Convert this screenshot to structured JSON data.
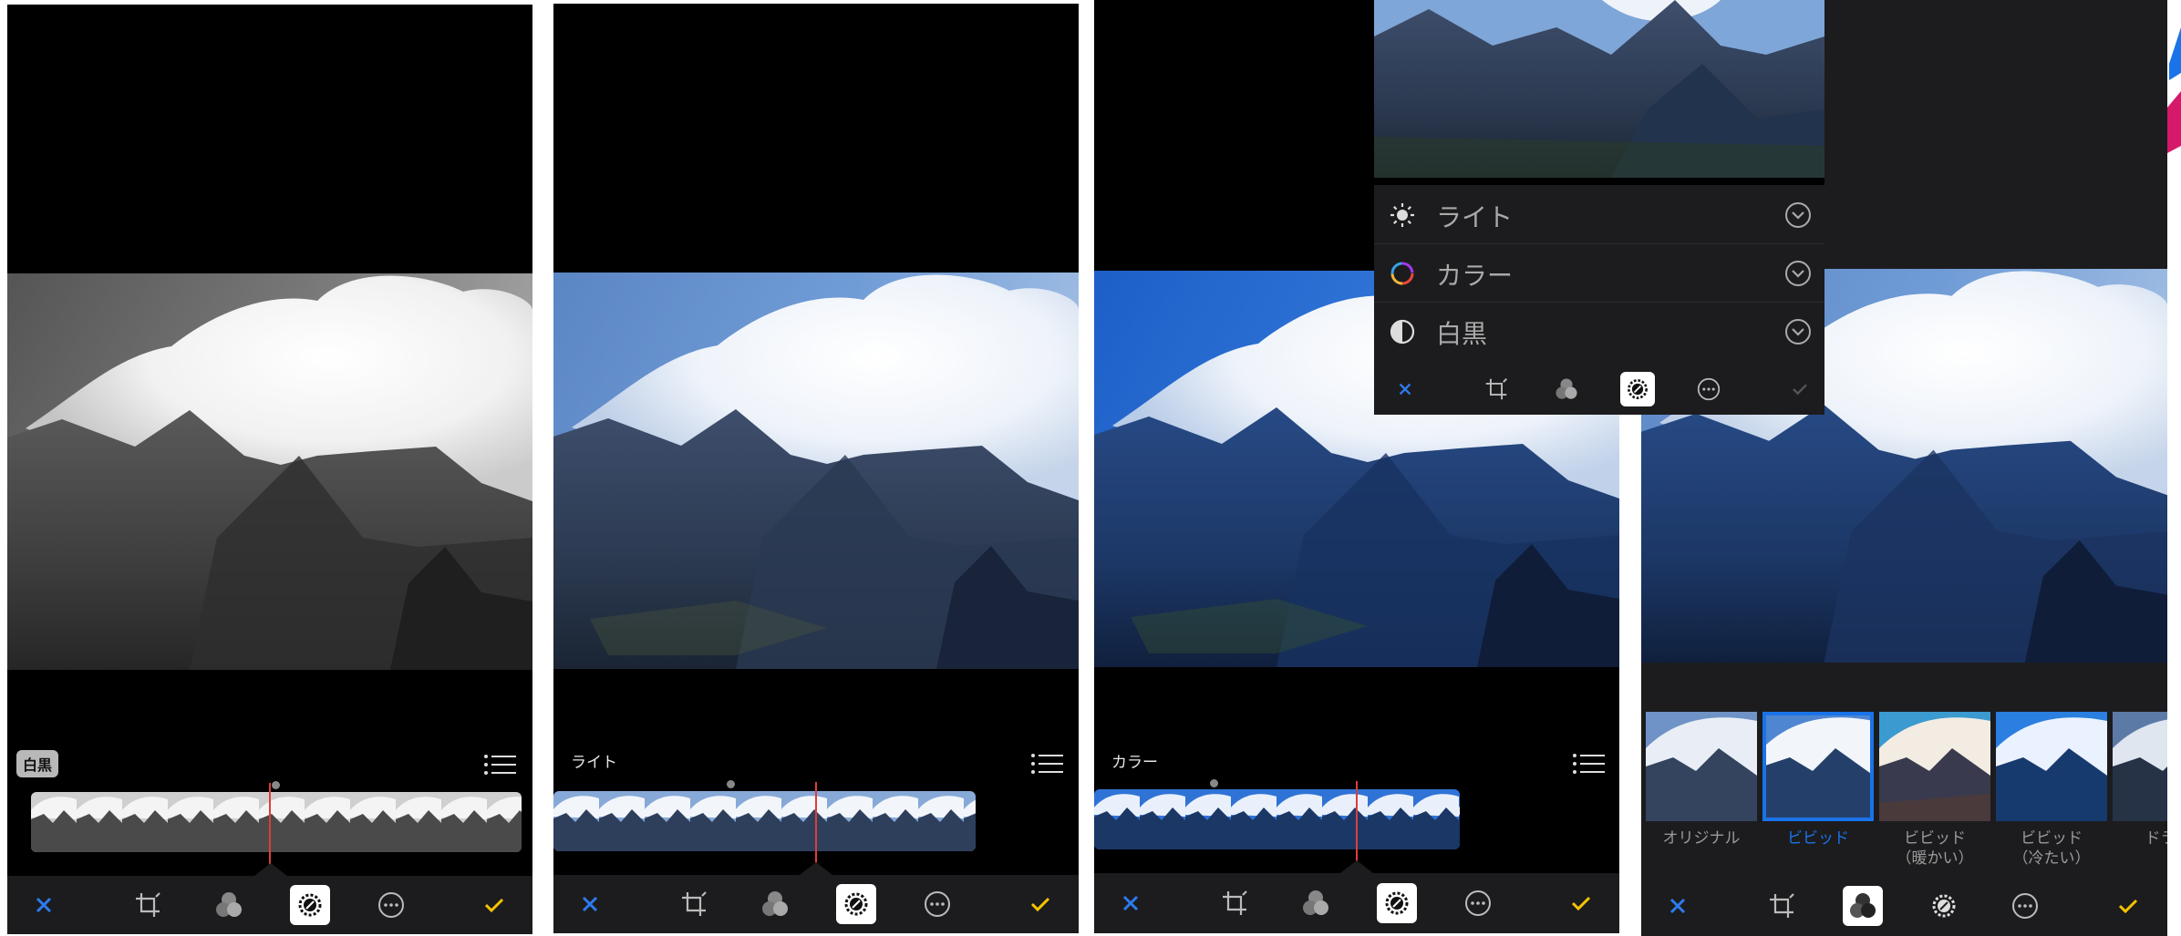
{
  "panels": [
    {
      "mode": "bw",
      "label": "白黒",
      "label_style": "badge"
    },
    {
      "mode": "color",
      "label": "ライト",
      "label_style": "plain"
    },
    {
      "mode": "color",
      "label": "カラー",
      "label_style": "plain"
    }
  ],
  "menu": {
    "items": [
      {
        "label": "ライト",
        "icon": "sun-icon"
      },
      {
        "label": "カラー",
        "icon": "color-wheel-icon"
      },
      {
        "label": "白黒",
        "icon": "half-circle-icon"
      }
    ]
  },
  "filters": {
    "thumbnails": [
      {
        "label": "オリジナル",
        "label2": "",
        "selected": false
      },
      {
        "label": "ビビッド",
        "label2": "",
        "selected": true
      },
      {
        "label": "ビビッド",
        "label2": "（暖かい）",
        "selected": false
      },
      {
        "label": "ビビッド",
        "label2": "（冷たい）",
        "selected": false
      },
      {
        "label": "ドラマ",
        "label2": "",
        "selected": false
      }
    ]
  },
  "toolbar": {
    "cancel_icon": "close-icon",
    "crop_icon": "crop-icon",
    "filters_icon": "filters-icon",
    "adjust_icon": "adjust-dial-icon",
    "more_icon": "more-icon",
    "done_icon": "checkmark-icon"
  },
  "colors": {
    "accent_blue": "#1a73e8",
    "done_yellow": "#f5c400",
    "playhead_red": "#e03b3b",
    "toolbar_bg": "#1c1c1e"
  }
}
